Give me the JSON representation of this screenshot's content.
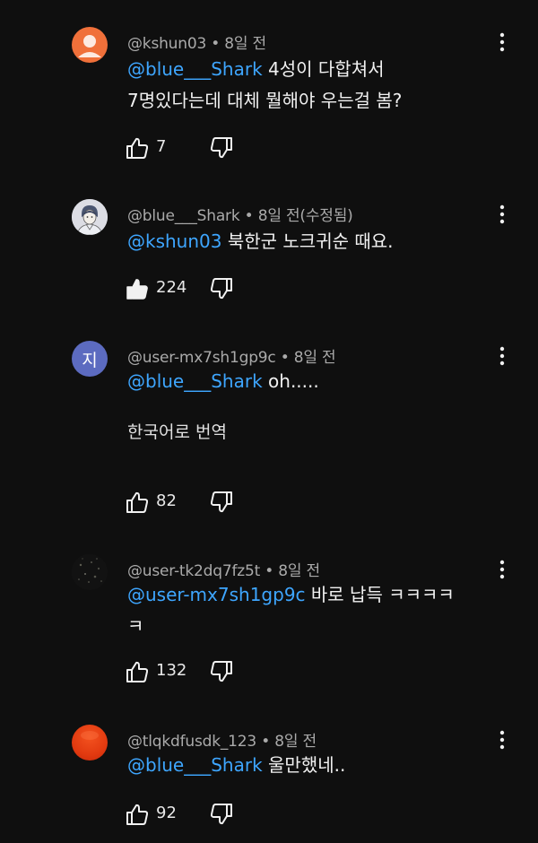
{
  "comments": [
    {
      "username": "@kshun03",
      "meta": " • 8일 전",
      "mention": "@blue___Shark",
      "line1": " 4성이 다합쳐서",
      "line2": "7명있다는데 대체 뭘해야 우는걸 봄?",
      "likes": "7",
      "avatar": "default-person-icon",
      "avatar_color": "#f0703a"
    },
    {
      "username": "@blue___Shark",
      "meta": " • 8일 전(수정됨)",
      "mention": "@kshun03",
      "line1": "  북한군 노크귀순 때요.",
      "likes": "224",
      "liked": true,
      "avatar": "sketch-boy-avatar"
    },
    {
      "username": "@user-mx7sh1gp9c",
      "meta": " • 8일 전",
      "mention": "@blue___Shark",
      "line1": " oh.....",
      "translate": "한국어로 번역",
      "likes": "82",
      "avatar_letter": "지",
      "avatar_color": "#5c6bc0"
    },
    {
      "username": "@user-tk2dq7fz5t",
      "meta": " • 8일 전",
      "mention": "@user-mx7sh1gp9c",
      "line1": "  바로 납득 ㅋㅋㅋㅋ",
      "line2": "ㅋ",
      "likes": "132",
      "avatar": "dark-texture-avatar"
    },
    {
      "username": "@tlqkdfusdk_123",
      "meta": " • 8일 전",
      "mention": "@blue___Shark",
      "line1": "  울만했네..",
      "likes": "92",
      "avatar": "red-orb-avatar",
      "avatar_color": "#e23a10"
    }
  ]
}
